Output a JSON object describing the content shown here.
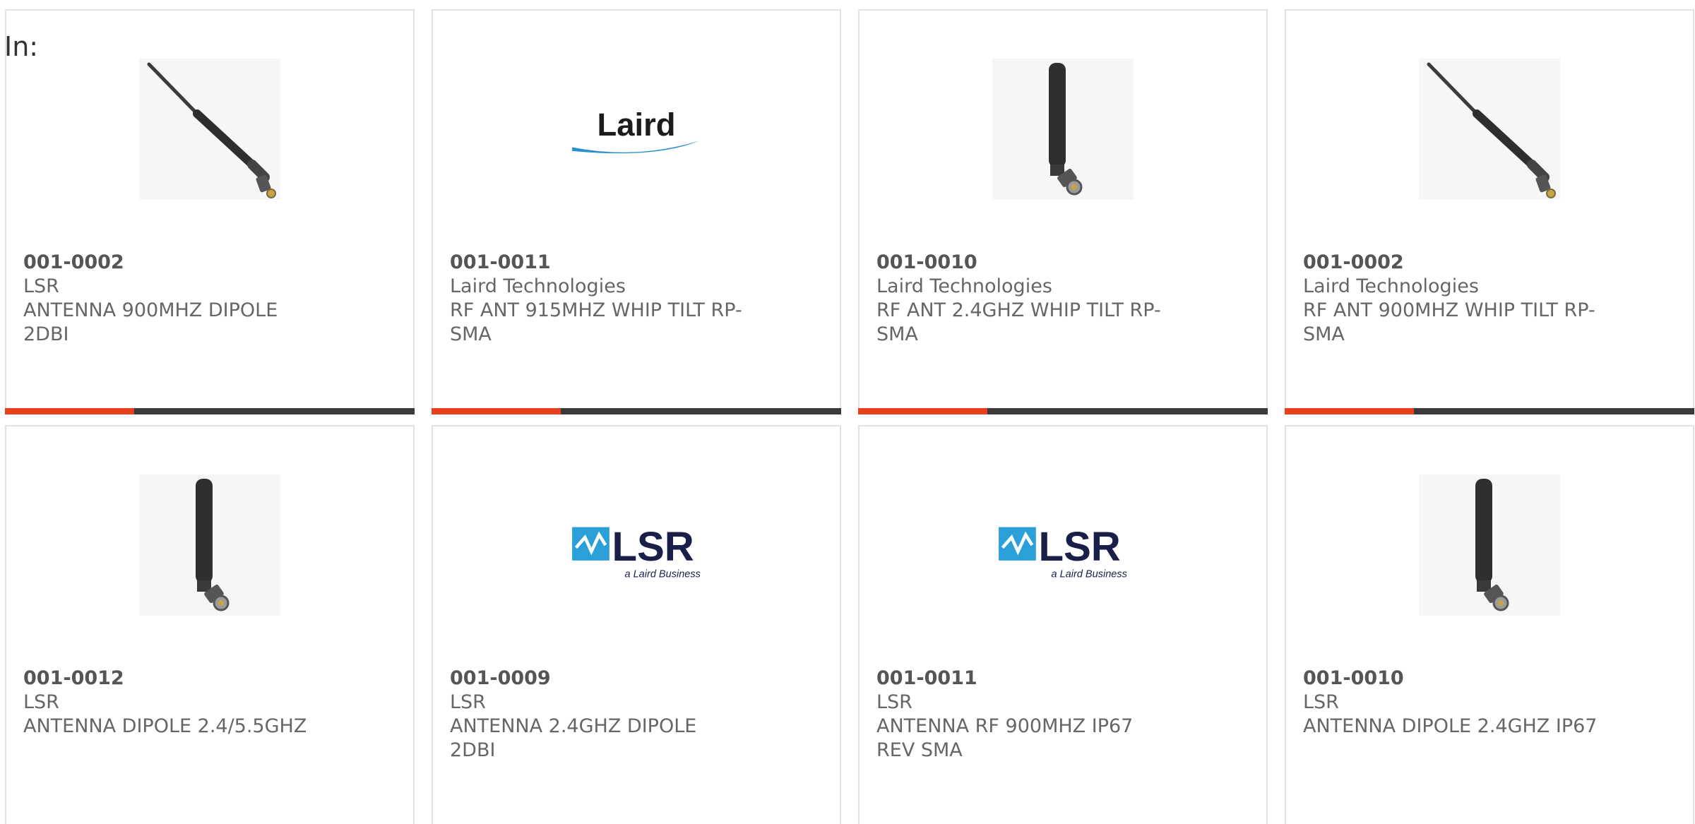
{
  "header": {
    "in_label": "In:"
  },
  "brand": {
    "accent_color": "#e8401c",
    "bar_color": "#3a3a3a"
  },
  "cards": [
    {
      "part_number": "001-0002",
      "manufacturer": "LSR",
      "description": "ANTENNA 900MHZ DIPOLE 2DBI",
      "image": "tilted-antenna-photo"
    },
    {
      "part_number": "001-0011",
      "manufacturer": "Laird Technologies",
      "description": "RF ANT 915MHZ WHIP TILT RP-SMA",
      "image": "laird-logo",
      "logo_text": "Laird"
    },
    {
      "part_number": "001-0010",
      "manufacturer": "Laird Technologies",
      "description": "RF ANT 2.4GHZ WHIP TILT RP-SMA",
      "image": "vertical-antenna-photo"
    },
    {
      "part_number": "001-0002",
      "manufacturer": "Laird Technologies",
      "description": "RF ANT 900MHZ WHIP TILT RP-SMA",
      "image": "tilted-antenna-photo"
    },
    {
      "part_number": "001-0012",
      "manufacturer": "LSR",
      "description": "ANTENNA DIPOLE 2.4/5.5GHZ",
      "image": "vertical-antenna-photo"
    },
    {
      "part_number": "001-0009",
      "manufacturer": "LSR",
      "description": "ANTENNA 2.4GHZ DIPOLE 2DBI",
      "image": "lsr-logo",
      "logo_text": "LSR",
      "logo_subtext": "a Laird Business"
    },
    {
      "part_number": "001-0011",
      "manufacturer": "LSR",
      "description": "ANTENNA RF 900MHZ IP67 REV SMA",
      "image": "lsr-logo",
      "logo_text": "LSR",
      "logo_subtext": "a Laird Business"
    },
    {
      "part_number": "001-0010",
      "manufacturer": "LSR",
      "description": "ANTENNA DIPOLE 2.4GHZ IP67",
      "image": "vertical-antenna-photo"
    }
  ]
}
